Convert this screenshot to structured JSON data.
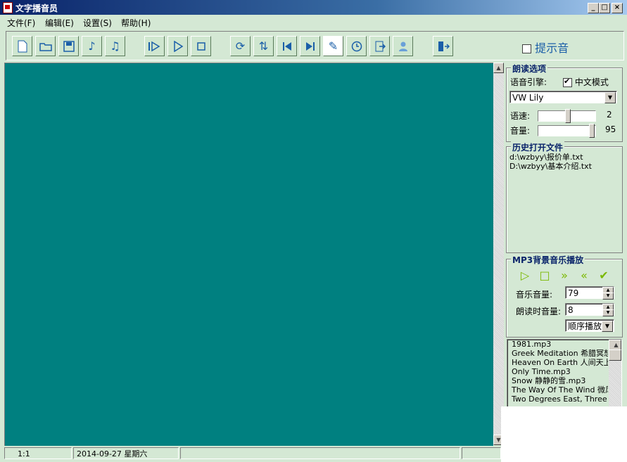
{
  "window": {
    "title": "文字播音员",
    "buttons": {
      "minimize": "_",
      "maximize": "□",
      "close": "×"
    }
  },
  "menu": {
    "items": [
      "文件(F)",
      "编辑(E)",
      "设置(S)",
      "帮助(H)"
    ]
  },
  "toolbar": {
    "icons": [
      "new-file-icon",
      "open-folder-icon",
      "save-icon",
      "music-note-icon",
      "music-notes-icon",
      "play-from-icon",
      "play-icon",
      "stop-icon",
      "refresh-icon",
      "loop-icon",
      "skip-back-icon",
      "skip-forward-icon",
      "edit-icon",
      "clock-icon",
      "export-icon",
      "user-icon",
      "exit-icon"
    ],
    "hint_sound_label": "提示音",
    "hint_sound_checked": false
  },
  "reading_options": {
    "title": "朗读选项",
    "engine_label": "语音引擎:",
    "chinese_mode_label": "中文模式",
    "chinese_mode_checked": true,
    "voice": "VW Lily",
    "speed_label": "语速:",
    "speed_value": "2",
    "volume_label": "音量:",
    "volume_value": "95"
  },
  "history": {
    "title": "历史打开文件",
    "files": [
      "d:\\wzbyy\\报价单.txt",
      "D:\\wzbyy\\基本介绍.txt"
    ]
  },
  "mp3": {
    "title": "MP3背景音乐播放",
    "music_volume_label": "音乐音量:",
    "music_volume_value": "79",
    "reading_volume_label": "朗读时音量:",
    "reading_volume_value": "8",
    "play_mode": "顺序播放",
    "playlist": [
      "1981.mp3",
      "Greek Meditation 希腊冥想曲",
      "Heaven On Earth 人间天上.m",
      "Only Time.mp3",
      "Snow 静静的雪.mp3",
      "The Way Of The Wind 微风吹",
      "Two Degrees East, Three Deg"
    ]
  },
  "status": {
    "position": "1:1",
    "date": "2014-09-27  星期六"
  }
}
